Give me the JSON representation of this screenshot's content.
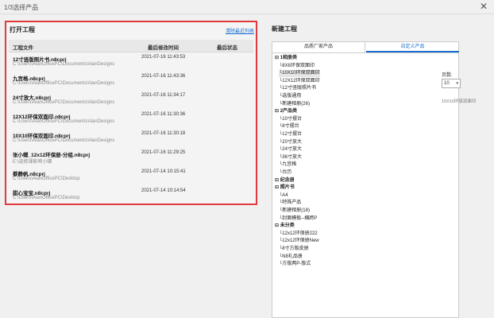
{
  "window": {
    "title": "1/3选择产品"
  },
  "open_project": {
    "header": "打开工程",
    "clear_link": "清除最近列表",
    "columns": [
      "工程文件",
      "最后修改时间",
      "最后状态"
    ],
    "rows": [
      {
        "name": "12寸竖版照片书.n8cprj",
        "path": "C:\\Users\\AlanOfficePC\\Documents\\AlanDesigns",
        "time": "2021-07-16 11:43:53"
      },
      {
        "name": "九宫格.n8cprj",
        "path": "C:\\Users\\AlanOfficePC\\Documents\\AlanDesigns",
        "time": "2021-07-16 11:43:36"
      },
      {
        "name": "24寸放大.n8cprj",
        "path": "C:\\Users\\AlanOfficePC\\Documents\\AlanDesigns",
        "time": "2021-07-16 11:34:17"
      },
      {
        "name": "12X12环保双面印.n8cprj",
        "path": "C:\\Users\\AlanOfficePC\\Documents\\AlanDesigns",
        "time": "2021-07-16 11:30:36"
      },
      {
        "name": "10X10环保双面印.n8cprj",
        "path": "C:\\Users\\AlanOfficePC\\Documents\\AlanDesigns",
        "time": "2021-07-16 11:30:18"
      },
      {
        "name": "张小蝶_12x12环保册-分组.n8cprj",
        "path": "E:\\选修课影响小蝶",
        "time": "2021-07-16 11:29:25"
      },
      {
        "name": "蔡静帆.n8cprj",
        "path": "C:\\Users\\AlanOfficePC\\Desktop",
        "time": "2021-07-14 10:15:41"
      },
      {
        "name": "甜心宝宝.n8cprj",
        "path": "C:\\Users\\AlanOfficePC\\Desktop",
        "time": "2021-07-14 10:14:54"
      }
    ]
  },
  "new_project": {
    "header": "新建工程",
    "tabs": [
      "品质厂家产品",
      "自定义产品"
    ],
    "tree": [
      {
        "label": "1相册类",
        "level": 0,
        "group": true
      },
      {
        "label": "8X8环保双面印",
        "level": 1
      },
      {
        "label": "10X10环保双面印",
        "level": 1,
        "selected": true
      },
      {
        "label": "12X12环保双面印",
        "level": 1
      },
      {
        "label": "12寸竖版照片书",
        "level": 1
      },
      {
        "label": "选版通用",
        "level": 1
      },
      {
        "label": "新建相册(26)",
        "level": 1
      },
      {
        "label": "2产品类",
        "level": 0,
        "group": true
      },
      {
        "label": "10寸摆台",
        "level": 1
      },
      {
        "label": "8寸摆台",
        "level": 1
      },
      {
        "label": "12寸摆台",
        "level": 1
      },
      {
        "label": "20寸放大",
        "level": 1
      },
      {
        "label": "24寸放大",
        "level": 1
      },
      {
        "label": "36寸放大",
        "level": 1
      },
      {
        "label": "九宫格",
        "level": 1
      },
      {
        "label": "台历",
        "level": 1
      },
      {
        "label": "纪念册",
        "level": 0,
        "group": true
      },
      {
        "label": "照片书",
        "level": 0,
        "group": true
      },
      {
        "label": "A4",
        "level": 1
      },
      {
        "label": "特殊产品",
        "level": 1
      },
      {
        "label": "新建相册(18)",
        "level": 1
      },
      {
        "label": "封面模板--横跨P",
        "level": 1
      },
      {
        "label": "未分类",
        "level": 0,
        "group": true
      },
      {
        "label": "12x12环保册222",
        "level": 1
      },
      {
        "label": "12x12环保册New",
        "level": 1
      },
      {
        "label": "8寸方版皮册",
        "level": 1
      },
      {
        "label": "N8礼品册",
        "level": 1
      },
      {
        "label": "方版两P-版式",
        "level": 1
      }
    ],
    "pages_label": "页数:",
    "pages_value": "10",
    "size_label": "10X10环保双面印"
  },
  "icons": {
    "close": "close-icon",
    "caret": "chevron-down-icon"
  }
}
